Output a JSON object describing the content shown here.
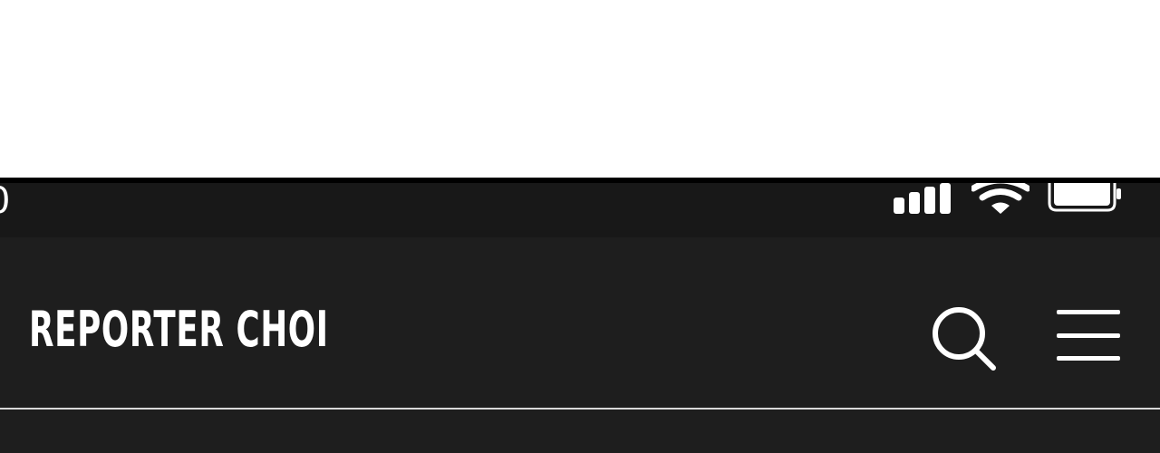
{
  "status_bar": {
    "time_fragment": "0",
    "icons": [
      "signal-icon",
      "wifi-icon",
      "battery-icon"
    ]
  },
  "header": {
    "brand": "REPORTER CHOI",
    "actions": [
      "search-icon",
      "menu-icon"
    ]
  },
  "colors": {
    "status_bar_bg": "#181818",
    "header_bg": "#1e1e1e",
    "text": "#ffffff",
    "divider": "#d9d9d9"
  }
}
